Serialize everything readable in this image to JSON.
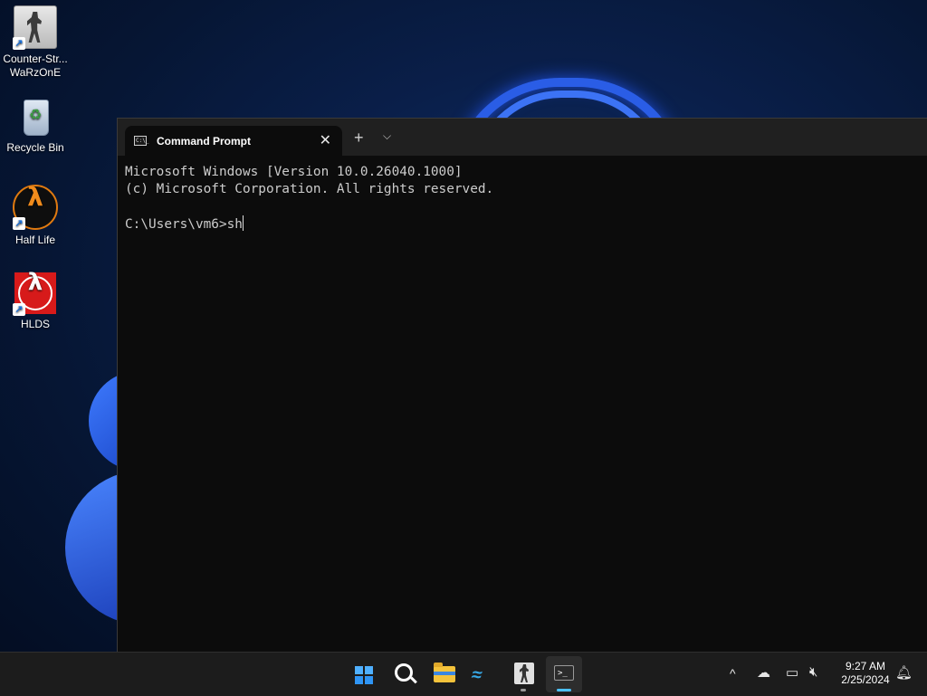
{
  "desktop": {
    "icons": [
      {
        "label_line1": "Counter-Str...",
        "label_line2": "WaRzOnE",
        "icon": "counter-strike-icon",
        "shortcut": true
      },
      {
        "label_line1": "Recycle Bin",
        "icon": "recycle-bin-icon",
        "shortcut": false
      },
      {
        "label_line1": "Half Life",
        "icon": "half-life-icon",
        "shortcut": true
      },
      {
        "label_line1": "HLDS",
        "icon": "hlds-icon",
        "shortcut": true
      }
    ]
  },
  "terminal": {
    "tab_title": "Command Prompt",
    "tab_icon_text": "C:\\_",
    "close_glyph": "✕",
    "new_tab_glyph": "+",
    "dropdown_glyph": "⌵",
    "lines": [
      "Microsoft Windows [Version 10.0.26040.1000]",
      "(c) Microsoft Corporation. All rights reserved.",
      "",
      "C:\\Users\\vm6>sh"
    ],
    "background": "#0c0c0c",
    "foreground": "#cccccc"
  },
  "taskbar": {
    "apps": [
      "start-icon",
      "search-icon",
      "file-explorer-icon",
      "dolphin-icon",
      "counter-strike-icon",
      "terminal-icon"
    ],
    "terminal_glyph": ">_",
    "dolphin_glyph": "≈",
    "tray": {
      "chevron": "^",
      "clock_time": "9:27 AM",
      "clock_date": "2/25/2024"
    }
  }
}
